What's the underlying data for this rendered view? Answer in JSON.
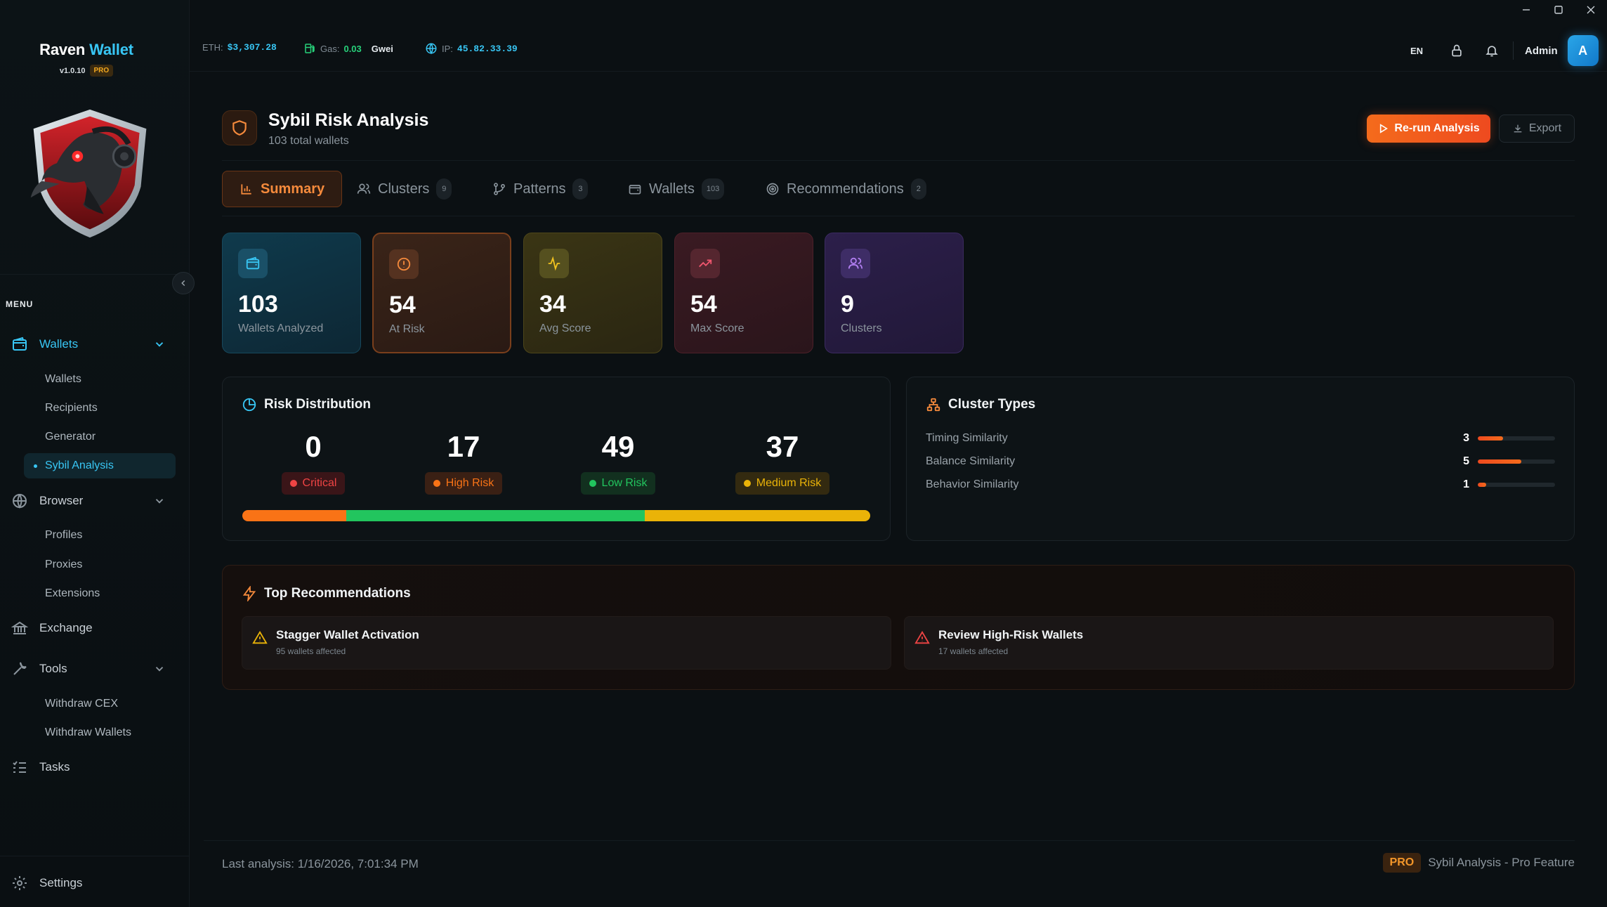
{
  "brand": {
    "name": "Raven",
    "accent_name": "Wallet",
    "version": "v1.0.10",
    "badge": "PRO"
  },
  "window_controls": [
    "minimize",
    "maximize",
    "close"
  ],
  "topbar": {
    "eth_label": "ETH:",
    "eth_value": "$3,307.28",
    "gas_label": "Gas:",
    "gas_value": "0.03",
    "gas_unit": "Gwei",
    "ip_label": "IP:",
    "ip_value": "45.82.33.39",
    "language": "EN",
    "user_name": "Admin",
    "avatar_letter": "A"
  },
  "sidebar": {
    "menu_label": "MENU",
    "wallets": {
      "label": "Wallets",
      "items": [
        "Wallets",
        "Recipients",
        "Generator",
        "Sybil Analysis"
      ]
    },
    "browser": {
      "label": "Browser",
      "items": [
        "Profiles",
        "Proxies",
        "Extensions"
      ]
    },
    "exchange": {
      "label": "Exchange"
    },
    "tools": {
      "label": "Tools",
      "items": [
        "Withdraw CEX",
        "Withdraw Wallets"
      ]
    },
    "tasks": {
      "label": "Tasks"
    },
    "settings": {
      "label": "Settings"
    }
  },
  "page": {
    "title": "Sybil Risk Analysis",
    "subtitle": "103 total wallets",
    "rerun_label": "Re-run Analysis",
    "export_label": "Export"
  },
  "tabs": [
    {
      "label": "Summary",
      "count": ""
    },
    {
      "label": "Clusters",
      "count": "9"
    },
    {
      "label": "Patterns",
      "count": "3"
    },
    {
      "label": "Wallets",
      "count": "103"
    },
    {
      "label": "Recommendations",
      "count": "2"
    }
  ],
  "stats": [
    {
      "value": "103",
      "label": "Wallets Analyzed",
      "icon": "wallet-icon",
      "color": "#38c6f4"
    },
    {
      "value": "54",
      "label": "At Risk",
      "icon": "alert-circle-icon",
      "color": "#f58a3c"
    },
    {
      "value": "34",
      "label": "Avg Score",
      "icon": "activity-icon",
      "color": "#f2c21f"
    },
    {
      "value": "54",
      "label": "Max Score",
      "icon": "trending-up-icon",
      "color": "#f0566e"
    },
    {
      "value": "9",
      "label": "Clusters",
      "icon": "users-icon",
      "color": "#b07ef0"
    }
  ],
  "risk_distribution": {
    "title": "Risk Distribution",
    "items": [
      {
        "value": "0",
        "label": "Critical",
        "color": "#ef4444"
      },
      {
        "value": "17",
        "label": "High Risk",
        "color": "#f97316"
      },
      {
        "value": "49",
        "label": "Low Risk",
        "color": "#22c55e"
      },
      {
        "value": "37",
        "label": "Medium Risk",
        "color": "#eab308"
      }
    ],
    "bar_segments": [
      {
        "label": "High Risk",
        "value": 17,
        "color": "#f97316"
      },
      {
        "label": "Low Risk",
        "value": 49,
        "color": "#22c55e"
      },
      {
        "label": "Medium Risk",
        "value": 37,
        "color": "#eab308"
      }
    ]
  },
  "cluster_types": {
    "title": "Cluster Types",
    "items": [
      {
        "label": "Timing Similarity",
        "count": "3",
        "fraction": 0.33
      },
      {
        "label": "Balance Similarity",
        "count": "5",
        "fraction": 0.56
      },
      {
        "label": "Behavior Similarity",
        "count": "1",
        "fraction": 0.11
      }
    ]
  },
  "recommendations": {
    "title": "Top Recommendations",
    "items": [
      {
        "title": "Stagger Wallet Activation",
        "subtitle": "95 wallets affected",
        "color": "#eab308"
      },
      {
        "title": "Review High-Risk Wallets",
        "subtitle": "17 wallets affected",
        "color": "#ef4444"
      }
    ]
  },
  "footer": {
    "last_analysis": "Last analysis: 1/16/2026, 7:01:34 PM",
    "pro_badge": "PRO",
    "pro_text": "Sybil Analysis - Pro Feature"
  }
}
